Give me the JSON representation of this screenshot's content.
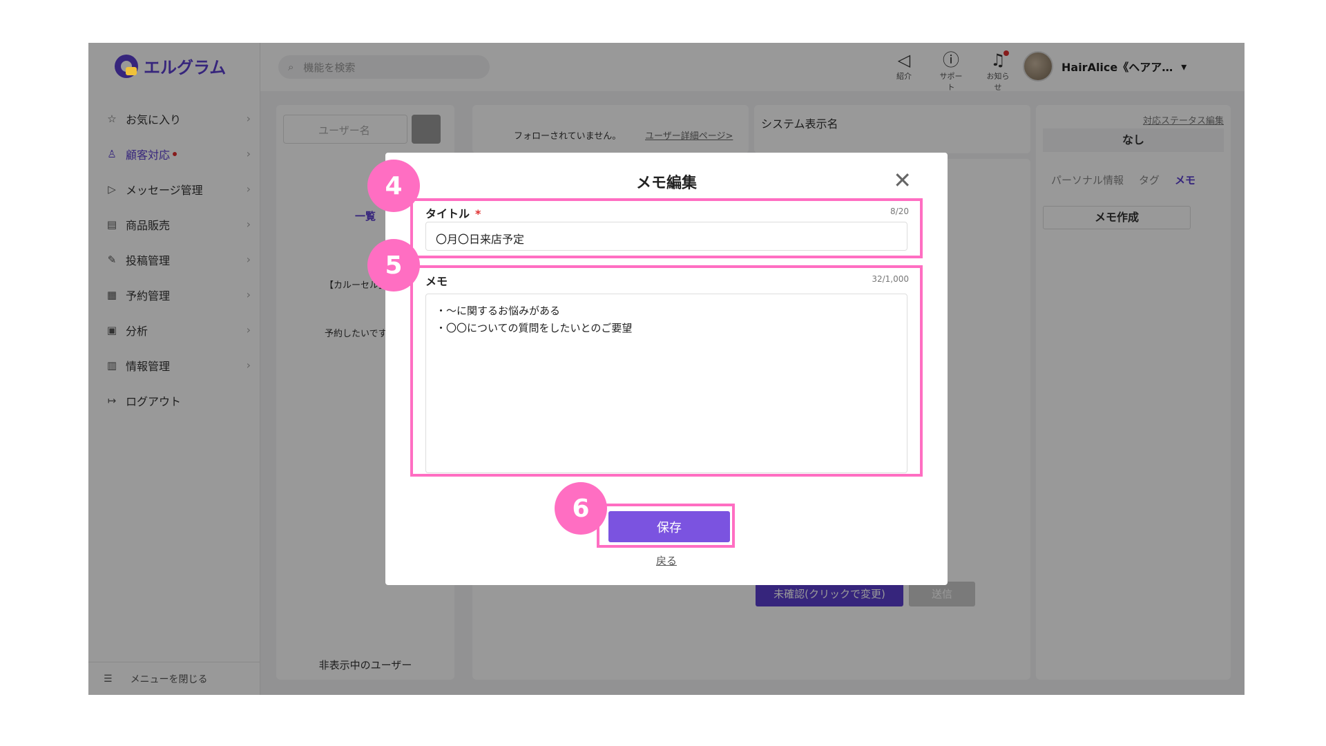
{
  "app": {
    "name": "エルグラム"
  },
  "sidebar": {
    "items": [
      {
        "label": "お気に入り",
        "icon": "star-icon"
      },
      {
        "label": "顧客対応",
        "icon": "user-icon",
        "active": true,
        "notify": true
      },
      {
        "label": "メッセージ管理",
        "icon": "send-icon"
      },
      {
        "label": "商品販売",
        "icon": "shop-icon"
      },
      {
        "label": "投稿管理",
        "icon": "edit-icon"
      },
      {
        "label": "予約管理",
        "icon": "calendar-icon"
      },
      {
        "label": "分析",
        "icon": "report-icon"
      },
      {
        "label": "情報管理",
        "icon": "chart-icon"
      },
      {
        "label": "ログアウト",
        "icon": "logout-icon"
      }
    ],
    "close_menu": "メニューを閉じる"
  },
  "topbar": {
    "search_placeholder": "機能を検索",
    "icons": [
      {
        "label": "紹介",
        "icon": "megaphone-icon"
      },
      {
        "label": "サポート",
        "icon": "help-icon"
      },
      {
        "label": "お知らせ",
        "icon": "bell-icon",
        "notify": true
      }
    ],
    "user_name": "HairAlice《ヘアア…"
  },
  "user_list": {
    "search_placeholder": "ユーザー名",
    "tab": "一覧",
    "rows": [
      {
        "text": "【カルーセル】"
      },
      {
        "text": "予約したいです。"
      }
    ],
    "hidden_users": "非表示中のユーザー"
  },
  "chat_header": {
    "status": "フォローされていません。",
    "detail_link": "ユーザー詳細ページ>"
  },
  "system_name": {
    "label": "システム表示名"
  },
  "right_panel": {
    "status_edit": "対応ステータス編集",
    "status_value": "なし",
    "tabs": [
      "パーソナル情報",
      "タグ",
      "メモ"
    ],
    "active_tab": "メモ",
    "create_memo": "メモ作成"
  },
  "chat_footer": {
    "unread": "未確認(クリックで変更)",
    "send": "送信"
  },
  "modal": {
    "title": "メモ編集",
    "title_label": "タイトル",
    "title_counter": "8/20",
    "title_value": "〇月〇日来店予定",
    "memo_label": "メモ",
    "memo_counter": "32/1,000",
    "memo_value": "・〜に関するお悩みがある\n・〇〇についての質問をしたいとのご要望",
    "save": "保存",
    "back": "戻る"
  },
  "callouts": [
    "4",
    "5",
    "6"
  ],
  "colors": {
    "accent": "#5b3fcf",
    "button": "#7b53e0",
    "highlight": "#ff6ec2",
    "notify": "#e03030"
  }
}
